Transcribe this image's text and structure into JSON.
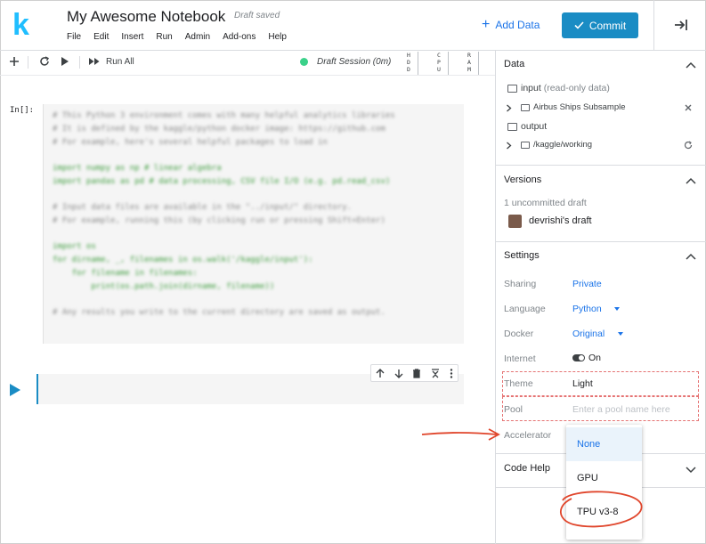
{
  "header": {
    "title": "My Awesome Notebook",
    "draft_status": "Draft saved",
    "menu": [
      "File",
      "Edit",
      "Insert",
      "Run",
      "Admin",
      "Add-ons",
      "Help"
    ],
    "add_data_label": "Add Data",
    "commit_label": "Commit",
    "logo_letter": "k",
    "brand_color": "#20beff",
    "accent_color": "#1a8cc4"
  },
  "toolbar": {
    "run_all_label": "Run All",
    "session_label": "Draft Session (0m)",
    "meters": [
      "HDD",
      "CPU",
      "RAM"
    ]
  },
  "notebook": {
    "cell_prompt": "In[]:",
    "code_lines": [
      {
        "text": "# This Python 3 environment comes with many helpful analytics libraries",
        "style": "normal"
      },
      {
        "text": "# It is defined by the kaggle/python docker image: https://github.com",
        "style": "normal"
      },
      {
        "text": "# For example, here's several helpful packages to load in",
        "style": "normal"
      },
      {
        "text": "",
        "style": "gap"
      },
      {
        "text": "import numpy as np # linear algebra",
        "style": "green"
      },
      {
        "text": "import pandas as pd # data processing, CSV file I/O (e.g. pd.read_csv)",
        "style": "green"
      },
      {
        "text": "",
        "style": "gap"
      },
      {
        "text": "# Input data files are available in the \"../input/\" directory.",
        "style": "normal"
      },
      {
        "text": "# For example, running this (by clicking run or pressing Shift+Enter)",
        "style": "normal"
      },
      {
        "text": "",
        "style": "gap"
      },
      {
        "text": "import os",
        "style": "green"
      },
      {
        "text": "for dirname, _, filenames in os.walk('/kaggle/input'):",
        "style": "green"
      },
      {
        "text": "    for filename in filenames:",
        "style": "green"
      },
      {
        "text": "        print(os.path.join(dirname, filename))",
        "style": "green"
      },
      {
        "text": "",
        "style": "gap"
      },
      {
        "text": "# Any results you write to the current directory are saved as output.",
        "style": "normal"
      }
    ]
  },
  "panel": {
    "data": {
      "heading": "Data",
      "input_label": "input",
      "input_note": "(read-only data)",
      "input_item": "Airbus Ships Subsample",
      "output_label": "output",
      "output_item": "/kaggle/working"
    },
    "versions": {
      "heading": "Versions",
      "uncommitted": "1 uncommitted draft",
      "draft_owner": "devrishi's draft"
    },
    "settings": {
      "heading": "Settings",
      "rows": {
        "sharing": {
          "label": "Sharing",
          "value": "Private"
        },
        "language": {
          "label": "Language",
          "value": "Python"
        },
        "docker": {
          "label": "Docker",
          "value": "Original"
        },
        "internet": {
          "label": "Internet",
          "value": "On"
        },
        "theme": {
          "label": "Theme",
          "value": "Light"
        },
        "pool": {
          "label": "Pool",
          "placeholder": "Enter a pool name here"
        },
        "accelerator": {
          "label": "Accelerator"
        }
      }
    },
    "code_help": {
      "heading": "Code Help"
    }
  },
  "accelerator_dropdown": {
    "options": [
      "None",
      "GPU",
      "TPU v3-8"
    ],
    "selected": "None",
    "highlighted": "TPU v3-8"
  },
  "annotation_color": "#e0452b"
}
